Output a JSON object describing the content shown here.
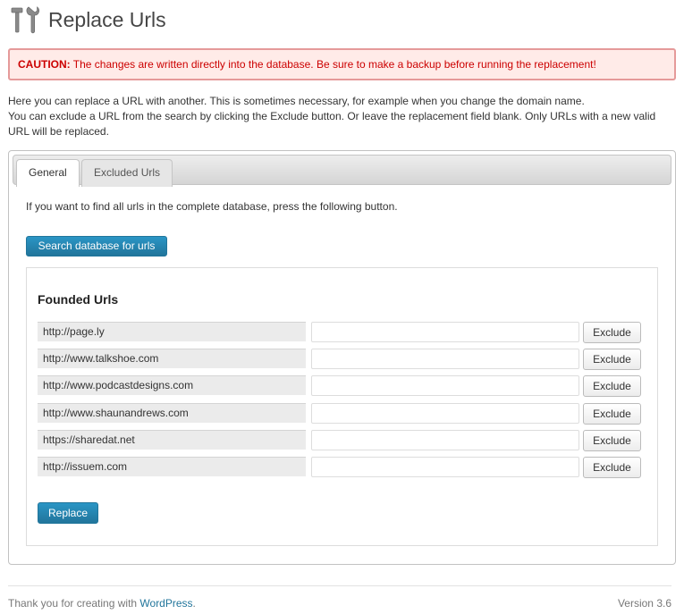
{
  "page": {
    "title": "Replace Urls",
    "icon": "tools-icon"
  },
  "caution": {
    "label": "CAUTION:",
    "text": " The changes are written directly into the database. Be sure to make a backup before running the replacement!"
  },
  "intro": {
    "line1": "Here you can replace a URL with another. This is sometimes necessary, for example when you change the domain name.",
    "line2": "You can exclude a URL from the search by clicking the Exclude button. Or leave the replacement field blank. Only URLs with a new valid URL will be replaced."
  },
  "tabs": [
    {
      "label": "General",
      "active": true
    },
    {
      "label": "Excluded Urls",
      "active": false
    }
  ],
  "general": {
    "find_text": "If you want to find all urls in the complete database, press the following button.",
    "search_button": "Search database for urls",
    "founded_title": "Founded Urls",
    "urls": [
      {
        "url": "http://page.ly",
        "replacement": "",
        "exclude_label": "Exclude"
      },
      {
        "url": "http://www.talkshoe.com",
        "replacement": "",
        "exclude_label": "Exclude"
      },
      {
        "url": "http://www.podcastdesigns.com",
        "replacement": "",
        "exclude_label": "Exclude"
      },
      {
        "url": "http://www.shaunandrews.com",
        "replacement": "",
        "exclude_label": "Exclude"
      },
      {
        "url": "https://sharedat.net",
        "replacement": "",
        "exclude_label": "Exclude"
      },
      {
        "url": "http://issuem.com",
        "replacement": "",
        "exclude_label": "Exclude"
      }
    ],
    "replace_button": "Replace"
  },
  "footer": {
    "thanks_prefix": "Thank you for creating with ",
    "wordpress_link": "WordPress",
    "thanks_suffix": ".",
    "version": "Version 3.6"
  },
  "colors": {
    "accent": "#21759b",
    "caution_text": "#cc0000",
    "caution_bg": "#ffebe8"
  }
}
